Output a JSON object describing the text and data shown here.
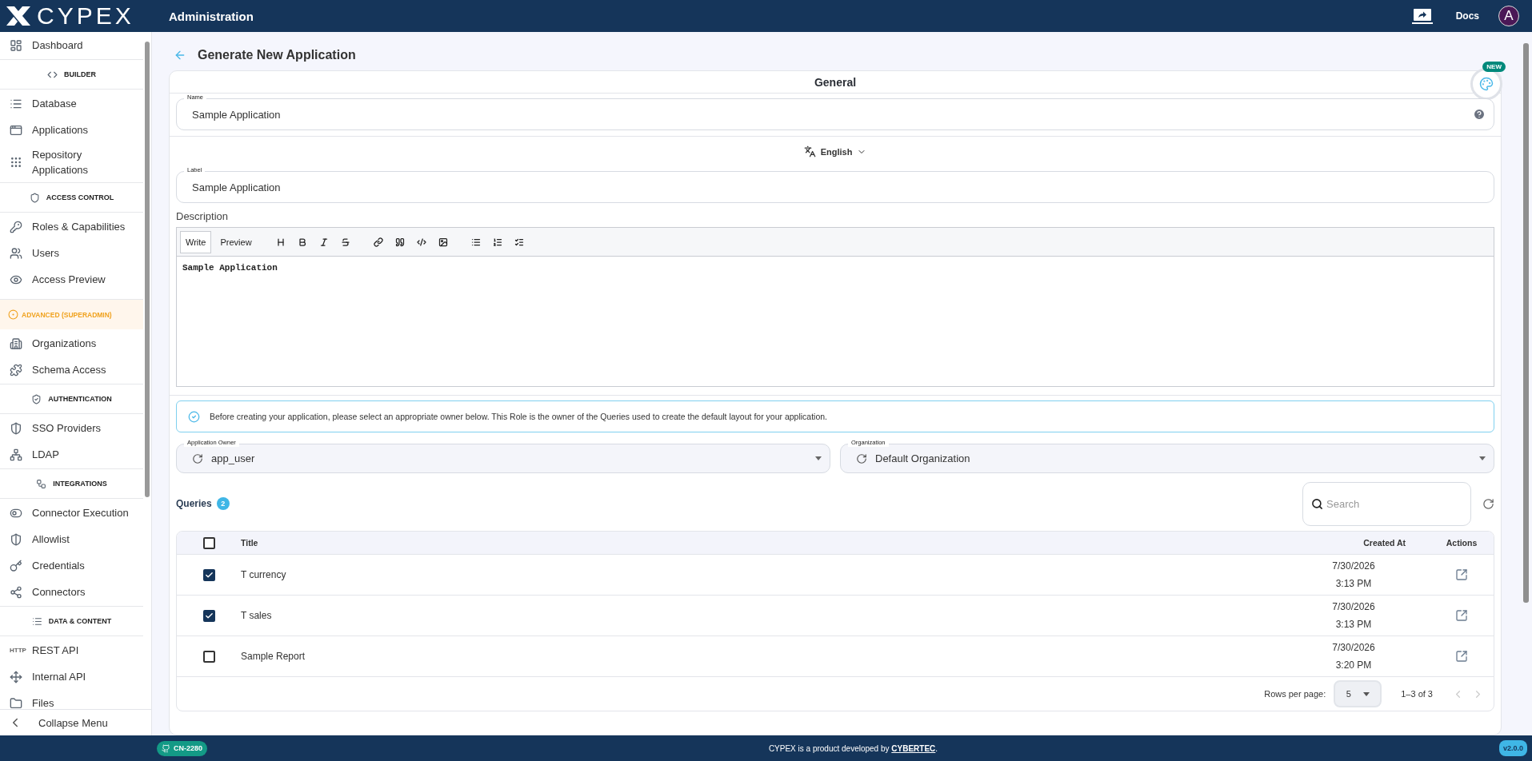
{
  "header": {
    "logo": "CYPEX",
    "title": "Administration",
    "docs": "Docs",
    "avatar": "A"
  },
  "sidebar": {
    "items": [
      {
        "kind": "link",
        "label": "Dashboard"
      },
      {
        "kind": "section",
        "label": "BUILDER"
      },
      {
        "kind": "link",
        "label": "Database"
      },
      {
        "kind": "link",
        "label": "Applications"
      },
      {
        "kind": "link",
        "label": "Repository Applications"
      },
      {
        "kind": "section",
        "label": "ACCESS CONTROL"
      },
      {
        "kind": "link",
        "label": "Roles & Capabilities"
      },
      {
        "kind": "link",
        "label": "Users"
      },
      {
        "kind": "link",
        "label": "Access Preview"
      },
      {
        "kind": "warning",
        "label": "ADVANCED (SUPERADMIN)"
      },
      {
        "kind": "link",
        "label": "Organizations"
      },
      {
        "kind": "link",
        "label": "Schema Access"
      },
      {
        "kind": "section",
        "label": "AUTHENTICATION"
      },
      {
        "kind": "link",
        "label": "SSO Providers"
      },
      {
        "kind": "link",
        "label": "LDAP"
      },
      {
        "kind": "section",
        "label": "INTEGRATIONS"
      },
      {
        "kind": "link",
        "label": "Connector Execution"
      },
      {
        "kind": "link",
        "label": "Allowlist"
      },
      {
        "kind": "link",
        "label": "Credentials"
      },
      {
        "kind": "link",
        "label": "Connectors"
      },
      {
        "kind": "section",
        "label": "DATA & CONTENT"
      },
      {
        "kind": "link",
        "label": "REST API",
        "icon_text": "HTTP"
      },
      {
        "kind": "link",
        "label": "Internal API"
      },
      {
        "kind": "link",
        "label": "Files"
      }
    ],
    "collapse": "Collapse Menu"
  },
  "page": {
    "title": "Generate New Application",
    "section": "General",
    "new_badge": "NEW",
    "name_field": {
      "label": "Name",
      "value": "Sample Application"
    },
    "language": "English",
    "label_field": {
      "label": "Label",
      "value": "Sample Application"
    },
    "description": {
      "label": "Description",
      "tabs": [
        {
          "label": "Write",
          "selected": true
        },
        {
          "label": "Preview",
          "selected": false
        }
      ],
      "value": "Sample Application"
    },
    "alert": "Before creating your application, please select an appropriate owner below. This Role is the owner of the Queries used to create the default layout for your application.",
    "selects": [
      {
        "label": "Application Owner",
        "value": "app_user"
      },
      {
        "label": "Organization",
        "value": "Default Organization"
      }
    ],
    "queries": {
      "title": "Queries",
      "count": "2",
      "search": {
        "placeholder": "Search"
      },
      "columns": [
        "Title",
        "Created At",
        "Actions"
      ],
      "all_checked": false,
      "rows": [
        {
          "checked": true,
          "title": "T currency",
          "date": "7/30/2026",
          "time": "3:13 PM"
        },
        {
          "checked": true,
          "title": "T sales",
          "date": "7/30/2026",
          "time": "3:13 PM"
        },
        {
          "checked": false,
          "title": "Sample Report",
          "date": "7/30/2026",
          "time": "3:20 PM"
        }
      ],
      "rows_per_page_label": "Rows per page:",
      "rows_per_page": "5",
      "range": "1–3 of 3"
    }
  },
  "footer": {
    "badge": "CN-2280",
    "text": "CYPEX is a product developed by",
    "link": "CYBERTEC",
    "after": ".",
    "version": "v2.0.0"
  }
}
